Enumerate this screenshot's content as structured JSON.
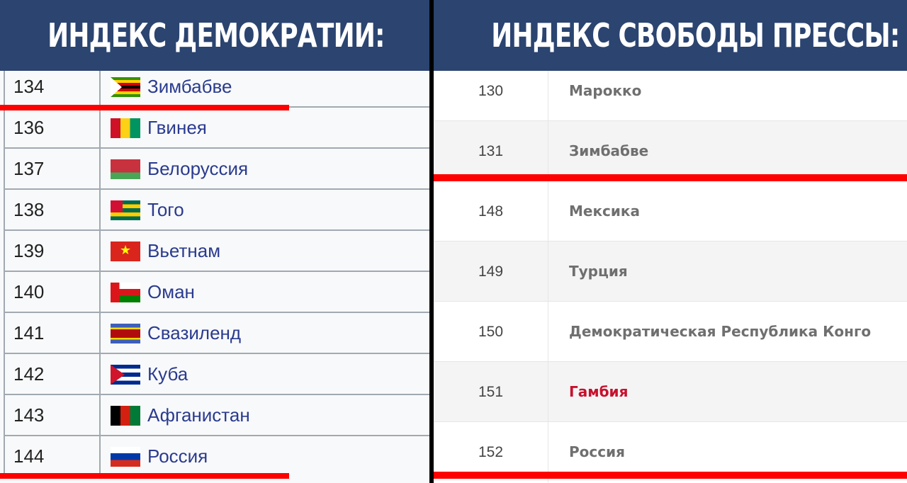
{
  "left": {
    "title": "ИНДЕКС ДЕМОКРАТИИ:",
    "rows": [
      {
        "rank": "134",
        "country": "Зимбабве",
        "flag": "zimbabwe-flag"
      },
      {
        "rank": "136",
        "country": "Гвинея",
        "flag": "guinea-flag"
      },
      {
        "rank": "137",
        "country": "Белоруссия",
        "flag": "belarus-flag"
      },
      {
        "rank": "138",
        "country": "Того",
        "flag": "togo-flag"
      },
      {
        "rank": "139",
        "country": "Вьетнам",
        "flag": "vietnam-flag"
      },
      {
        "rank": "140",
        "country": "Оман",
        "flag": "oman-flag"
      },
      {
        "rank": "141",
        "country": "Свазиленд",
        "flag": "eswatini-flag"
      },
      {
        "rank": "142",
        "country": "Куба",
        "flag": "cuba-flag"
      },
      {
        "rank": "143",
        "country": "Афганистан",
        "flag": "afghanistan-flag"
      },
      {
        "rank": "144",
        "country": "Россия",
        "flag": "russia-flag"
      }
    ]
  },
  "right": {
    "title": "ИНДЕКС СВОБОДЫ ПРЕССЫ:",
    "rows": [
      {
        "rank": "130",
        "country": "Марокко"
      },
      {
        "rank": "131",
        "country": "Зимбабве"
      },
      {
        "rank": "148",
        "country": "Мексика"
      },
      {
        "rank": "149",
        "country": "Турция"
      },
      {
        "rank": "150",
        "country": "Демократическая Республика Конго"
      },
      {
        "rank": "151",
        "country": "Гамбия",
        "highlight": true
      },
      {
        "rank": "152",
        "country": "Россия"
      }
    ]
  },
  "colors": {
    "header": "#2b4470",
    "underline": "#ff0000",
    "link": "#2a3b8f",
    "highlight": "#c8102e"
  }
}
